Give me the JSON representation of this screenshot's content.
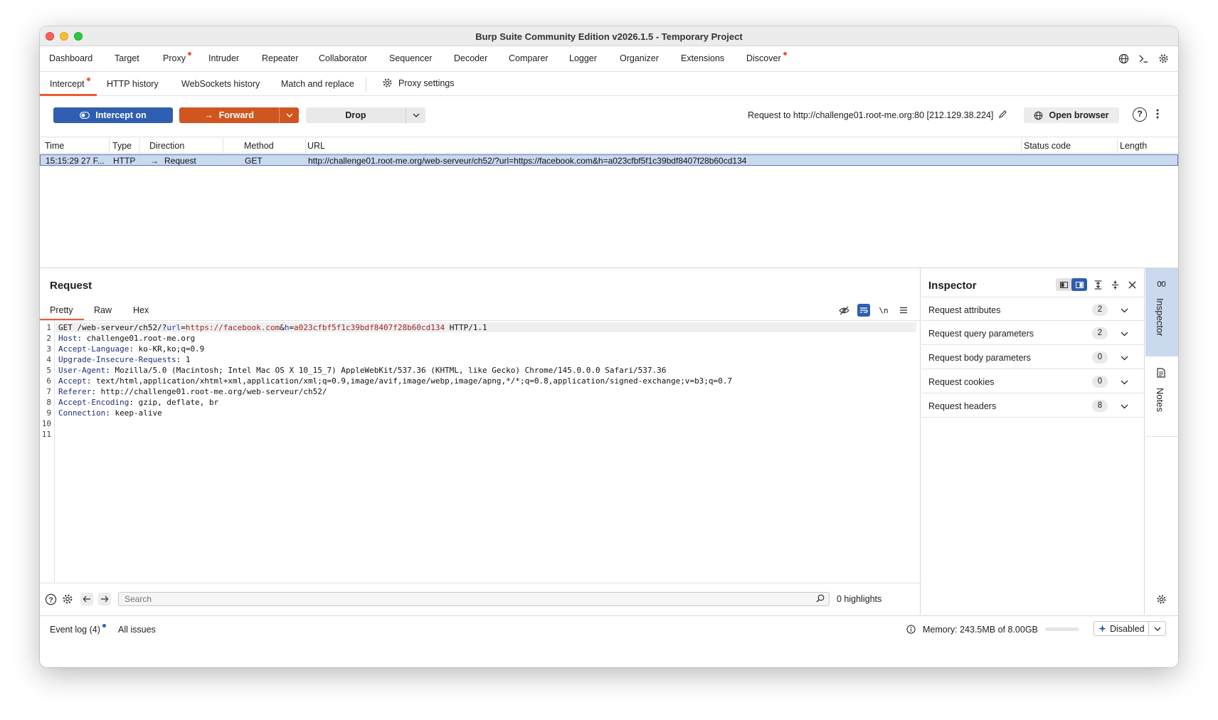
{
  "window": {
    "title": "Burp Suite Community Edition v2026.1.5 - Temporary Project"
  },
  "top_tabs": [
    {
      "label": "Dashboard",
      "dot": false
    },
    {
      "label": "Target",
      "dot": false
    },
    {
      "label": "Proxy",
      "dot": true,
      "active": true
    },
    {
      "label": "Intruder",
      "dot": false
    },
    {
      "label": "Repeater",
      "dot": false
    },
    {
      "label": "Collaborator",
      "dot": false
    },
    {
      "label": "Sequencer",
      "dot": false
    },
    {
      "label": "Decoder",
      "dot": false
    },
    {
      "label": "Comparer",
      "dot": false
    },
    {
      "label": "Logger",
      "dot": false
    },
    {
      "label": "Organizer",
      "dot": false
    },
    {
      "label": "Extensions",
      "dot": false
    },
    {
      "label": "Discover",
      "dot": true
    }
  ],
  "sub_tabs": [
    {
      "label": "Intercept",
      "dot": true,
      "active": true
    },
    {
      "label": "HTTP history"
    },
    {
      "label": "WebSockets history"
    },
    {
      "label": "Match and replace"
    }
  ],
  "proxy_settings_label": "Proxy settings",
  "actions": {
    "intercept": "Intercept on",
    "forward": "Forward",
    "drop": "Drop",
    "request_to": "Request to http://challenge01.root-me.org:80  [212.129.38.224]",
    "open_browser": "Open browser"
  },
  "table": {
    "columns": [
      "Time",
      "Type",
      "Direction",
      "Method",
      "URL",
      "Status code",
      "Length"
    ],
    "rows": [
      {
        "time": "15:15:29 27 F...",
        "type": "HTTP",
        "direction": "Request",
        "method": "GET",
        "url": "http://challenge01.root-me.org/web-serveur/ch52/?url=https://facebook.com&h=a023cfbf5f1c39bdf8407f28b60cd134",
        "status": "",
        "length": ""
      }
    ]
  },
  "request": {
    "title": "Request",
    "view_tabs": [
      "Pretty",
      "Raw",
      "Hex"
    ],
    "line_numbers": [
      "1",
      "2",
      "3",
      "4",
      "5",
      "6",
      "7",
      "8",
      "9",
      "10",
      "11"
    ],
    "line1": {
      "method_path": "GET /web-serveur/ch52/?",
      "p1_key": "url",
      "eq1": "=",
      "p1_val": "https://facebook.com",
      "amp": "&",
      "p2_key": "h",
      "eq2": "=",
      "p2_val": "a023cfbf5f1c39bdf8407f28b60cd134",
      "version": " HTTP/1.1"
    },
    "headers": [
      {
        "name": "Host",
        "value": " challenge01.root-me.org"
      },
      {
        "name": "Accept-Language",
        "value": " ko-KR,ko;q=0.9"
      },
      {
        "name": "Upgrade-Insecure-Requests",
        "value": " 1"
      },
      {
        "name": "User-Agent",
        "value": " Mozilla/5.0 (Macintosh; Intel Mac OS X 10_15_7) AppleWebKit/537.36 (KHTML, like Gecko) Chrome/145.0.0.0 Safari/537.36"
      },
      {
        "name": "Accept",
        "value": " text/html,application/xhtml+xml,application/xml;q=0.9,image/avif,image/webp,image/apng,*/*;q=0.8,application/signed-exchange;v=b3;q=0.7"
      },
      {
        "name": "Referer",
        "value": " http://challenge01.root-me.org/web-serveur/ch52/"
      },
      {
        "name": "Accept-Encoding",
        "value": " gzip, deflate, br"
      },
      {
        "name": "Connection",
        "value": " keep-alive"
      }
    ],
    "newline_label": "\\n",
    "search_placeholder": "Search",
    "highlights": "0 highlights"
  },
  "inspector": {
    "title": "Inspector",
    "sections": [
      {
        "label": "Request attributes",
        "count": "2"
      },
      {
        "label": "Request query parameters",
        "count": "2"
      },
      {
        "label": "Request body parameters",
        "count": "0"
      },
      {
        "label": "Request cookies",
        "count": "0"
      },
      {
        "label": "Request headers",
        "count": "8"
      }
    ]
  },
  "sidebar": {
    "inspector_label": "Inspector",
    "notes_label": "Notes"
  },
  "status_bar": {
    "event_log": "Event log (4)",
    "all_issues": "All issues",
    "memory": "Memory: 243.5MB of 8.00GB",
    "ai_state": "Disabled"
  },
  "colors": {
    "accent_orange": "#d15521",
    "accent_blue": "#2f5eb0",
    "selected_row": "#cbd9ee"
  }
}
